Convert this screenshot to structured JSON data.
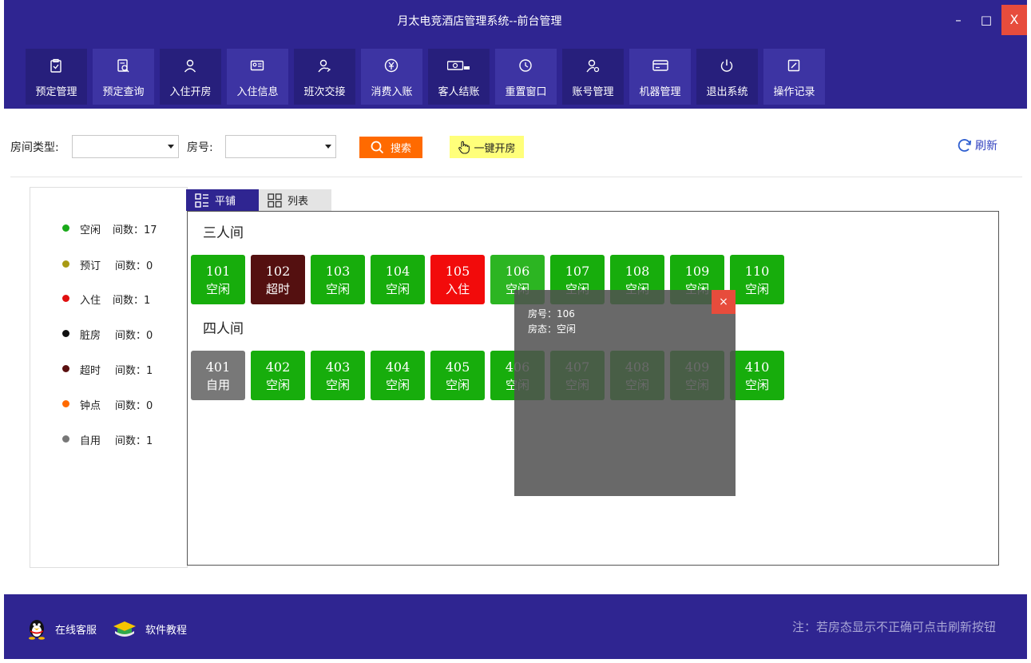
{
  "window": {
    "title": "月太电竞酒店管理系统--前台管理",
    "min": "–",
    "max": "□",
    "close": "X"
  },
  "nav": [
    {
      "label": "预定管理",
      "icon": "clipboard-check-icon"
    },
    {
      "label": "预定查询",
      "icon": "search-document-icon"
    },
    {
      "label": "入住开房",
      "icon": "user-checkin-icon"
    },
    {
      "label": "入住信息",
      "icon": "id-card-icon"
    },
    {
      "label": "班次交接",
      "icon": "user-swap-icon"
    },
    {
      "label": "消费入账",
      "icon": "yuan-circle-icon"
    },
    {
      "label": "客人结账",
      "icon": "cash-register-icon"
    },
    {
      "label": "重置窗口",
      "icon": "clock-reset-icon"
    },
    {
      "label": "账号管理",
      "icon": "user-settings-icon"
    },
    {
      "label": "机器管理",
      "icon": "credit-card-icon"
    },
    {
      "label": "退出系统",
      "icon": "power-icon"
    },
    {
      "label": "操作记录",
      "icon": "edit-square-icon"
    }
  ],
  "filters": {
    "room_type_label": "房间类型:",
    "room_type_value": "",
    "room_no_label": "房号:",
    "room_no_value": "",
    "search_label": "搜索",
    "one_click_label": "一键开房",
    "refresh_label": "刷新"
  },
  "legend": [
    {
      "name": "空闲",
      "count": "间数：17",
      "color": "#1aaa1a"
    },
    {
      "name": "预订",
      "count": "间数：0",
      "color": "#a89a14"
    },
    {
      "name": "入住",
      "count": "间数：1",
      "color": "#e01010"
    },
    {
      "name": "脏房",
      "count": "间数：0",
      "color": "#111111"
    },
    {
      "name": "超时",
      "count": "间数：1",
      "color": "#5a1010"
    },
    {
      "name": "钟点",
      "count": "间数：0",
      "color": "#ff6a00"
    },
    {
      "name": "自用",
      "count": "间数：1",
      "color": "#777777"
    }
  ],
  "tabs": {
    "tile": "平铺",
    "list": "列表"
  },
  "groups": [
    {
      "title": "三人间",
      "rooms": [
        {
          "num": "101",
          "status": "空闲",
          "color": "#17ad0c"
        },
        {
          "num": "102",
          "status": "超时",
          "color": "#541010"
        },
        {
          "num": "103",
          "status": "空闲",
          "color": "#17ad0c"
        },
        {
          "num": "104",
          "status": "空闲",
          "color": "#17ad0c"
        },
        {
          "num": "105",
          "status": "入住",
          "color": "#f20b0b"
        },
        {
          "num": "106",
          "status": "空闲",
          "color": "#2cb522"
        },
        {
          "num": "107",
          "status": "空闲",
          "color": "#17ad0c"
        },
        {
          "num": "108",
          "status": "空闲",
          "color": "#17ad0c"
        },
        {
          "num": "109",
          "status": "空闲",
          "color": "#17ad0c"
        },
        {
          "num": "110",
          "status": "空闲",
          "color": "#17ad0c"
        }
      ]
    },
    {
      "title": "四人间",
      "rooms": [
        {
          "num": "401",
          "status": "自用",
          "color": "#787878"
        },
        {
          "num": "402",
          "status": "空闲",
          "color": "#17ad0c"
        },
        {
          "num": "403",
          "status": "空闲",
          "color": "#17ad0c"
        },
        {
          "num": "404",
          "status": "空闲",
          "color": "#17ad0c"
        },
        {
          "num": "405",
          "status": "空闲",
          "color": "#17ad0c"
        },
        {
          "num": "406",
          "status": "空闲",
          "color": "#17ad0c"
        },
        {
          "num": "407",
          "status": "空闲",
          "color": "#17ad0c"
        },
        {
          "num": "408",
          "status": "空闲",
          "color": "#17ad0c"
        },
        {
          "num": "409",
          "status": "空闲",
          "color": "#17ad0c"
        },
        {
          "num": "410",
          "status": "空闲",
          "color": "#17ad0c"
        }
      ]
    }
  ],
  "tooltip": {
    "room_line": "房号：106",
    "status_line": "房态：空闲",
    "close": "×"
  },
  "footer": {
    "service": "在线客服",
    "tutorial": "软件教程",
    "note": "注：若房态显示不正确可点击刷新按钮"
  }
}
